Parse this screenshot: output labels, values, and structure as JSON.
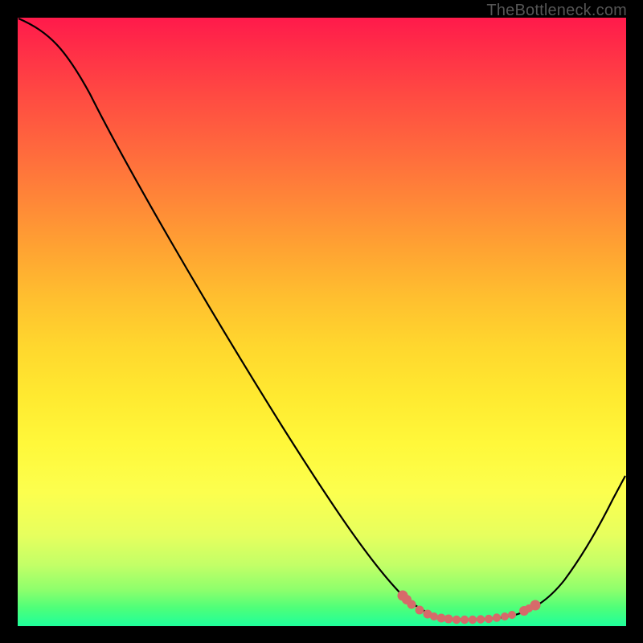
{
  "watermark": {
    "text": "TheBottleneck.com",
    "color": "#555555"
  },
  "chart_data": {
    "type": "line",
    "title": "",
    "xlabel": "",
    "ylabel": "",
    "xlim": [
      0,
      100
    ],
    "ylim": [
      0,
      100
    ],
    "x": [
      0,
      5,
      10,
      15,
      20,
      25,
      30,
      35,
      40,
      45,
      50,
      55,
      60,
      63,
      66,
      70,
      74,
      78,
      82,
      86,
      90,
      94,
      100
    ],
    "values": [
      100,
      98,
      94,
      87,
      79.5,
      71.5,
      63.5,
      55,
      46.5,
      38,
      29.5,
      21,
      12.5,
      7.5,
      4.5,
      2.2,
      1.2,
      1.2,
      2.0,
      4.5,
      8.5,
      14,
      24
    ],
    "valley": {
      "x_range": [
        63,
        82
      ],
      "color": "#d76a6a",
      "dot_radius_px": 6
    },
    "background_gradient": [
      "#ff1a4b",
      "#ff8a37",
      "#ffe930",
      "#1fff9b"
    ]
  }
}
